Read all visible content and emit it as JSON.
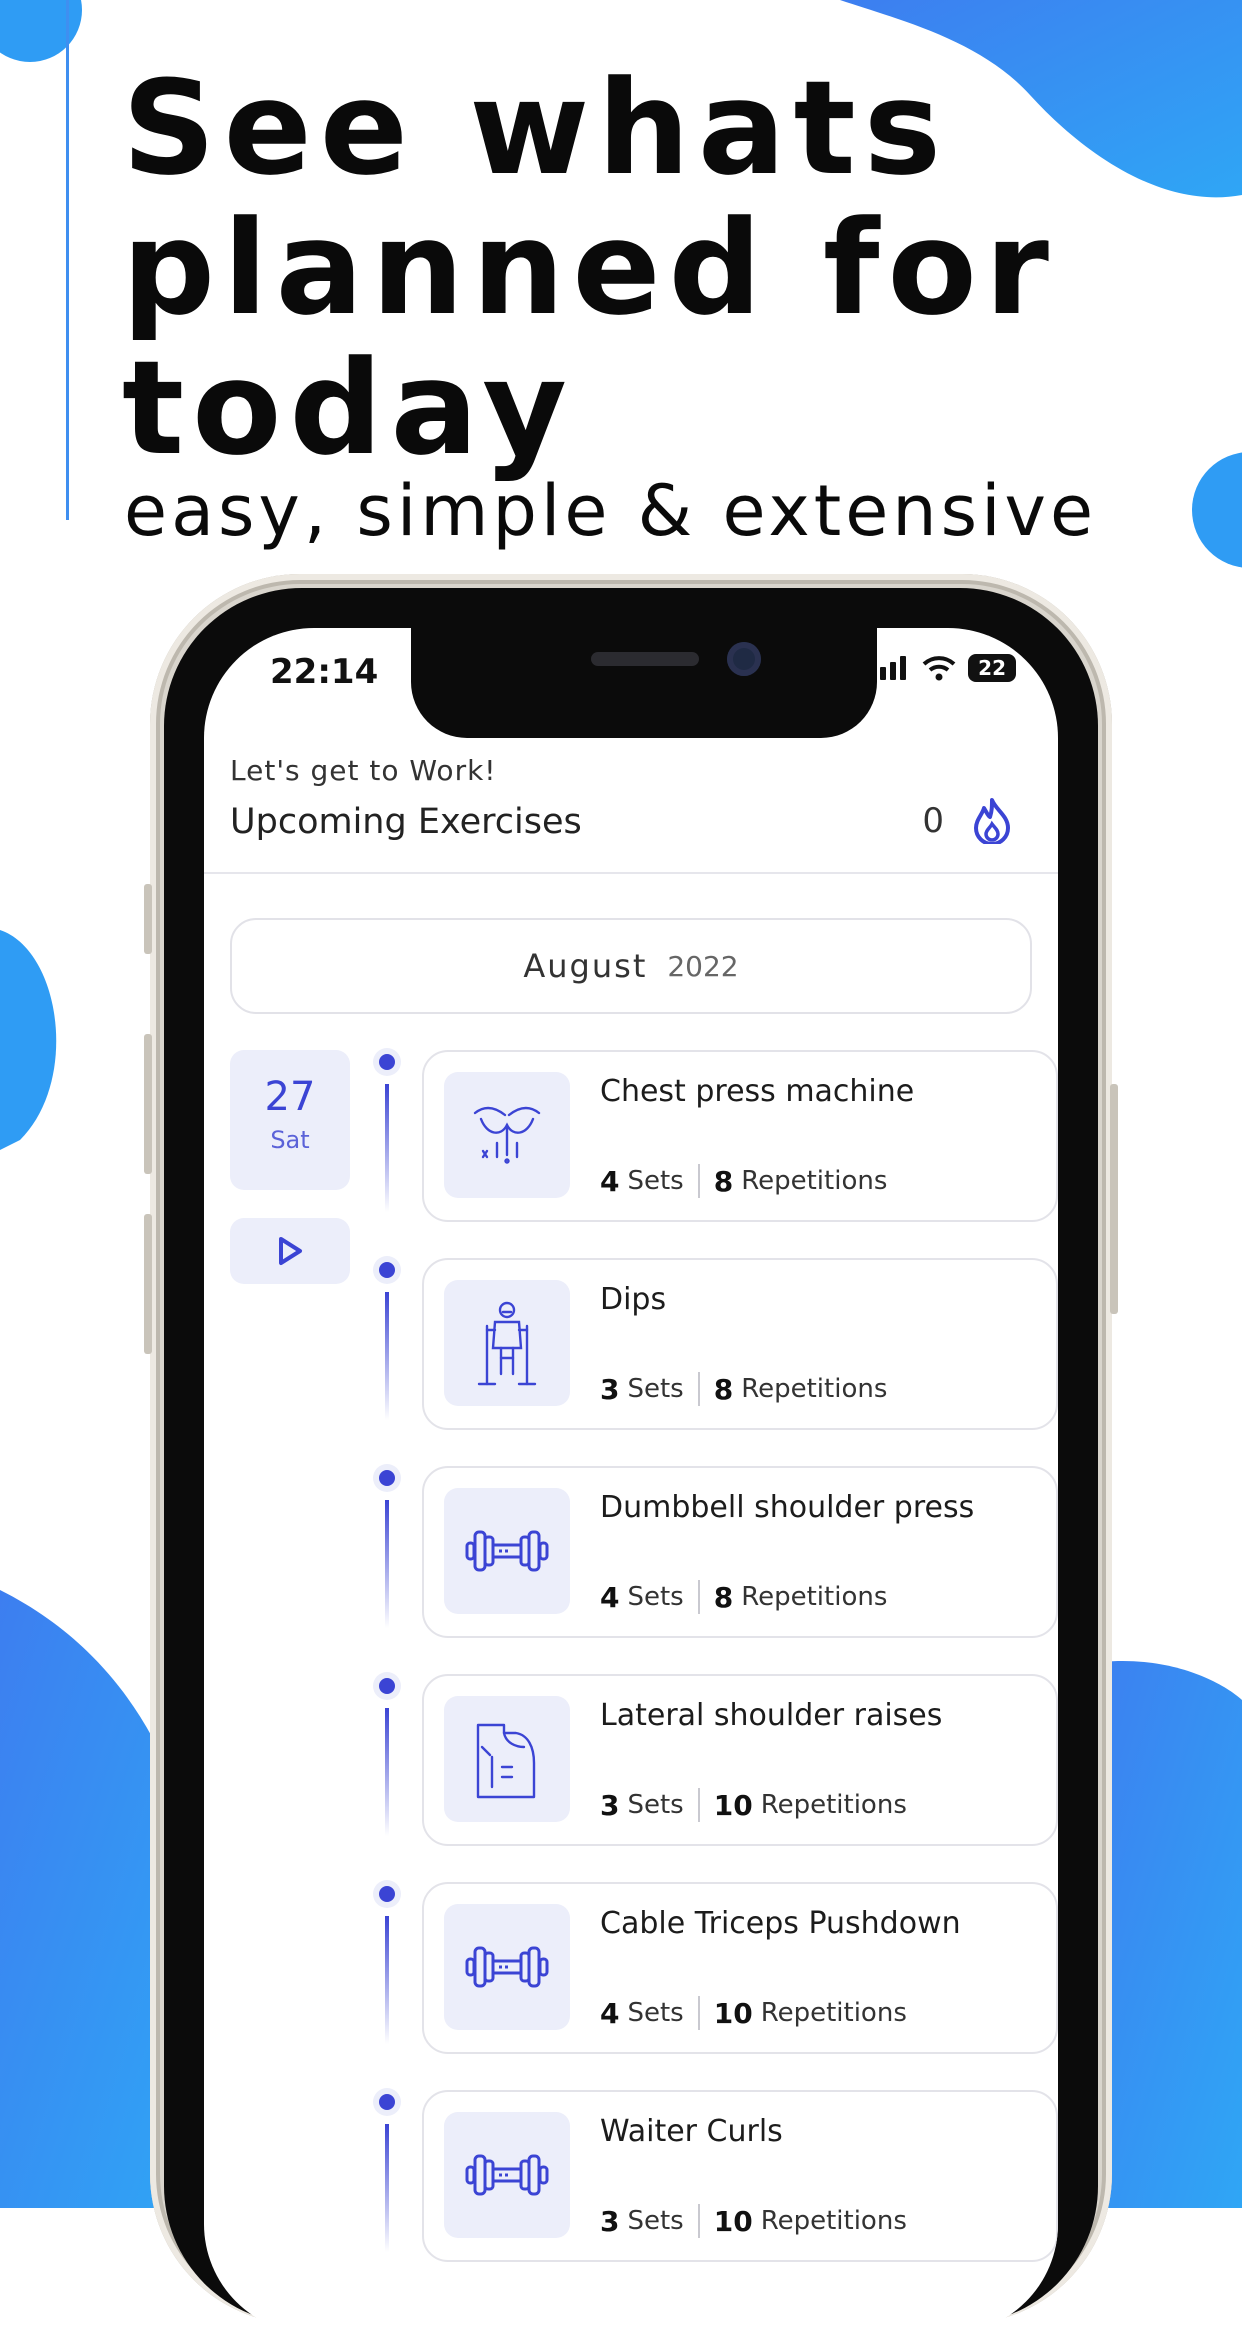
{
  "promo": {
    "headline_1": "See whats",
    "headline_2": "planned for",
    "headline_3": "today",
    "subline": "easy, simple & extensive"
  },
  "status_bar": {
    "time": "22:14",
    "battery": "22"
  },
  "header": {
    "greeting": "Let's get to Work!",
    "title": "Upcoming Exercises",
    "streak_count": "0",
    "streak_icon": "flame-icon"
  },
  "calendar": {
    "month": "August",
    "year": "2022",
    "date_number": "27",
    "day_name": "Sat"
  },
  "exercises": [
    {
      "name": "Chest press machine",
      "sets": "4",
      "sets_label": "Sets",
      "reps": "8",
      "reps_label": "Repetitions",
      "icon": "chest-muscle-icon"
    },
    {
      "name": "Dips",
      "sets": "3",
      "sets_label": "Sets",
      "reps": "8",
      "reps_label": "Repetitions",
      "icon": "dips-station-icon"
    },
    {
      "name": "Dumbbell shoulder press",
      "sets": "4",
      "sets_label": "Sets",
      "reps": "8",
      "reps_label": "Repetitions",
      "icon": "dumbbell-icon"
    },
    {
      "name": "Lateral shoulder raises",
      "sets": "3",
      "sets_label": "Sets",
      "reps": "10",
      "reps_label": "Repetitions",
      "icon": "shoulder-muscle-icon"
    },
    {
      "name": "Cable Triceps Pushdown",
      "sets": "4",
      "sets_label": "Sets",
      "reps": "10",
      "reps_label": "Repetitions",
      "icon": "dumbbell-icon"
    },
    {
      "name": "Waiter Curls",
      "sets": "3",
      "sets_label": "Sets",
      "reps": "10",
      "reps_label": "Repetitions",
      "icon": "dumbbell-icon"
    }
  ],
  "colors": {
    "accent": "#3b44d4",
    "tile_bg": "#eceefa",
    "background_blue": "#3aa0f3"
  }
}
